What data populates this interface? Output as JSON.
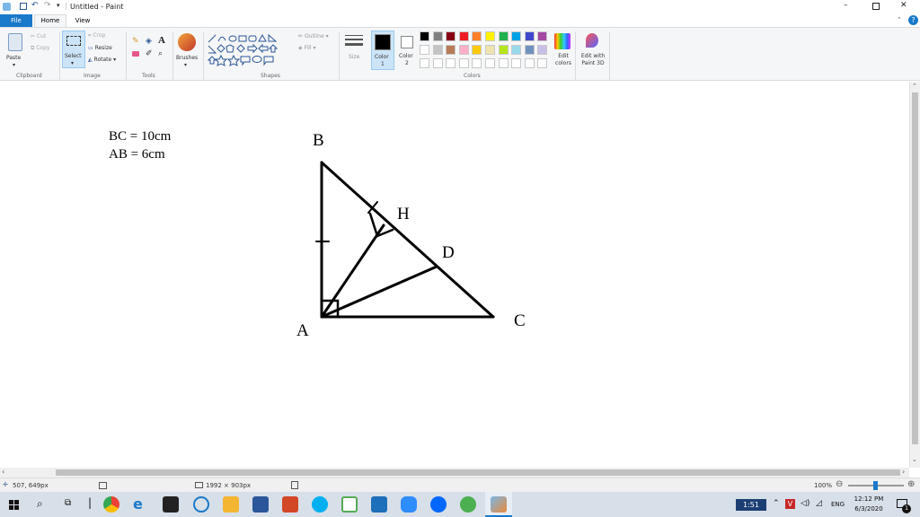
{
  "window": {
    "title": "Untitled - Paint"
  },
  "tabs": [
    "File",
    "Home",
    "View"
  ],
  "ribbon": {
    "clipboard": {
      "paste": "Paste",
      "cut": "Cut",
      "copy": "Copy",
      "label": "Clipboard"
    },
    "image": {
      "select": "Select",
      "crop": "Crop",
      "resize": "Resize",
      "rotate": "Rotate",
      "label": "Image"
    },
    "tools": {
      "label": "Tools",
      "text_tool": "A"
    },
    "brushes": {
      "label": "Brushes"
    },
    "shapes": {
      "outline": "Outline",
      "fill": "Fill",
      "label": "Shapes"
    },
    "size": {
      "label": "Size"
    },
    "color1": {
      "label": "Color",
      "sub": "1"
    },
    "color2": {
      "label": "Color",
      "sub": "2"
    },
    "colors": {
      "label": "Colors",
      "edit_colors": "Edit colors",
      "edit_paint3d": "Edit with Paint 3D"
    },
    "palette_row1": [
      "#000000",
      "#7f7f7f",
      "#880015",
      "#ed1c24",
      "#ff7f27",
      "#fff200",
      "#22b14c",
      "#00a2e8",
      "#3f48cc",
      "#a349a4"
    ],
    "palette_row2": [
      "#ffffff",
      "#c3c3c3",
      "#b97a57",
      "#ffaec9",
      "#ffc90e",
      "#efe4b0",
      "#b5e61d",
      "#99d9ea",
      "#7092be",
      "#c8bfe7"
    ]
  },
  "drawing": {
    "text_line1": "BC = 10cm",
    "text_line2": "AB = 6cm",
    "label_B": "B",
    "label_H": "H",
    "label_D": "D",
    "label_A": "A",
    "label_C": "C"
  },
  "status": {
    "cursor": "507, 649px",
    "canvas_size": "1992 × 903px",
    "zoom": "100%"
  },
  "taskbar": {
    "time_badge": "1:51",
    "lang": "ENG",
    "clock_time": "12:12 PM",
    "clock_date": "6/3/2020",
    "notif_count": "1"
  }
}
